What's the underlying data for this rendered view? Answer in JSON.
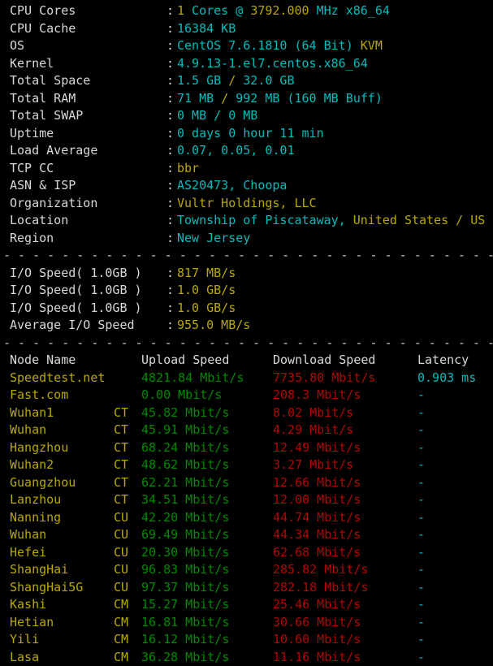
{
  "colors": {
    "background": "#000000",
    "label": "#d8d8d8",
    "cyan_value": "#00bcbc",
    "yellow_value": "#b8a800",
    "upload_green": "#008a00",
    "download_red": "#b00606",
    "separator": "#c8c8c8"
  },
  "system_info": {
    "rows": [
      {
        "label": "CPU Cores",
        "colon": ":",
        "segments": [
          {
            "t": "1",
            "c": "y"
          },
          {
            "t": " Cores @ ",
            "c": "c"
          },
          {
            "t": "3792.000",
            "c": "y"
          },
          {
            "t": " MHz x86_64",
            "c": "c"
          }
        ]
      },
      {
        "label": "CPU Cache",
        "colon": ":",
        "segments": [
          {
            "t": "16384 KB",
            "c": "c"
          }
        ]
      },
      {
        "label": "OS",
        "colon": ":",
        "segments": [
          {
            "t": "CentOS 7.6.1810 (64 Bit) ",
            "c": "c"
          },
          {
            "t": "KVM",
            "c": "y"
          }
        ]
      },
      {
        "label": "Kernel",
        "colon": ":",
        "segments": [
          {
            "t": "4.9.13-1.el7.centos.x86_64",
            "c": "c"
          }
        ]
      },
      {
        "label": "Total Space",
        "colon": ":",
        "segments": [
          {
            "t": "1.5 GB ",
            "c": "c"
          },
          {
            "t": "/",
            "c": "y"
          },
          {
            "t": " 32.0 GB",
            "c": "c"
          }
        ]
      },
      {
        "label": "Total RAM",
        "colon": ":",
        "segments": [
          {
            "t": "71 MB ",
            "c": "c"
          },
          {
            "t": "/",
            "c": "y"
          },
          {
            "t": " 992 MB ",
            "c": "c"
          },
          {
            "t": "(160 MB Buff)",
            "c": "c"
          }
        ]
      },
      {
        "label": "Total SWAP",
        "colon": ":",
        "segments": [
          {
            "t": "0 MB / 0 MB",
            "c": "c"
          }
        ]
      },
      {
        "label": "Uptime",
        "colon": ":",
        "segments": [
          {
            "t": "0 days 0 hour 11 min",
            "c": "c"
          }
        ]
      },
      {
        "label": "Load Average",
        "colon": ":",
        "segments": [
          {
            "t": "0.07, 0.05, 0.01",
            "c": "c"
          }
        ]
      },
      {
        "label": "TCP CC",
        "colon": ":",
        "segments": [
          {
            "t": "bbr",
            "c": "y"
          }
        ]
      },
      {
        "label": "ASN & ISP",
        "colon": ":",
        "segments": [
          {
            "t": "AS20473, Choopa",
            "c": "c"
          }
        ]
      },
      {
        "label": "Organization",
        "colon": ":",
        "segments": [
          {
            "t": "Vultr Holdings, LLC",
            "c": "y"
          }
        ]
      },
      {
        "label": "Location",
        "colon": ":",
        "segments": [
          {
            "t": "Township of Piscataway, ",
            "c": "c"
          },
          {
            "t": "United States / US",
            "c": "y"
          }
        ]
      },
      {
        "label": "Region",
        "colon": ":",
        "segments": [
          {
            "t": "New Jersey",
            "c": "c"
          }
        ]
      }
    ]
  },
  "separator": {
    "text": "- - - - - - - - - - - - - - - - - - - - - - - - - - - - - - - - - - - - - - - - - - - - - - - - - - -"
  },
  "io_block": {
    "rows": [
      {
        "label": "I/O Speed( 1.0GB )",
        "colon": ":",
        "value": "817 MB/s"
      },
      {
        "label": "I/O Speed( 1.0GB )",
        "colon": ":",
        "value": "1.0 GB/s"
      },
      {
        "label": "I/O Speed( 1.0GB )",
        "colon": ":",
        "value": "1.0 GB/s"
      },
      {
        "label": "Average I/O Speed",
        "colon": ":",
        "value": "955.0 MB/s"
      }
    ]
  },
  "speedtest": {
    "headers": {
      "node": "Node Name",
      "upload": "Upload Speed",
      "download": "Download Speed",
      "latency": "Latency"
    },
    "rows": [
      {
        "node": "Speedtest.net",
        "isp": "",
        "upload": "4821.84 Mbit/s",
        "download": "7735.80 Mbit/s",
        "latency": "0.903 ms"
      },
      {
        "node": "Fast.com",
        "isp": "",
        "upload": "0.00 Mbit/s",
        "download": "208.3 Mbit/s",
        "latency": "-"
      },
      {
        "node": "Wuhan1",
        "isp": "CT",
        "upload": "45.82 Mbit/s",
        "download": "8.02 Mbit/s",
        "latency": "-"
      },
      {
        "node": "Wuhan",
        "isp": "CT",
        "upload": "45.91 Mbit/s",
        "download": "4.29 Mbit/s",
        "latency": "-"
      },
      {
        "node": "Hangzhou",
        "isp": "CT",
        "upload": "68.24 Mbit/s",
        "download": "12.49 Mbit/s",
        "latency": "-"
      },
      {
        "node": "Wuhan2",
        "isp": "CT",
        "upload": "48.62 Mbit/s",
        "download": "3.27 Mbit/s",
        "latency": "-"
      },
      {
        "node": "Guangzhou",
        "isp": "CT",
        "upload": "62.21 Mbit/s",
        "download": "12.66 Mbit/s",
        "latency": "-"
      },
      {
        "node": "Lanzhou",
        "isp": "CT",
        "upload": "34.51 Mbit/s",
        "download": "12.00 Mbit/s",
        "latency": "-"
      },
      {
        "node": "Nanning",
        "isp": "CU",
        "upload": "42.20 Mbit/s",
        "download": "44.74 Mbit/s",
        "latency": "-"
      },
      {
        "node": "Wuhan",
        "isp": "CU",
        "upload": "69.49 Mbit/s",
        "download": "44.34 Mbit/s",
        "latency": "-"
      },
      {
        "node": "Hefei",
        "isp": "CU",
        "upload": "20.30 Mbit/s",
        "download": "62.68 Mbit/s",
        "latency": "-"
      },
      {
        "node": "ShangHai",
        "isp": "CU",
        "upload": "96.83 Mbit/s",
        "download": "285.82 Mbit/s",
        "latency": "-"
      },
      {
        "node": "ShangHai5G",
        "isp": "CU",
        "upload": "97.37 Mbit/s",
        "download": "282.18 Mbit/s",
        "latency": "-"
      },
      {
        "node": "Kashi",
        "isp": "CM",
        "upload": "15.27 Mbit/s",
        "download": "25.46 Mbit/s",
        "latency": "-"
      },
      {
        "node": "Hetian",
        "isp": "CM",
        "upload": "16.81 Mbit/s",
        "download": "30.66 Mbit/s",
        "latency": "-"
      },
      {
        "node": "Yili",
        "isp": "CM",
        "upload": "16.12 Mbit/s",
        "download": "10.60 Mbit/s",
        "latency": "-"
      },
      {
        "node": "Lasa",
        "isp": "CM",
        "upload": "36.28 Mbit/s",
        "download": "11.16 Mbit/s",
        "latency": "-"
      }
    ]
  }
}
